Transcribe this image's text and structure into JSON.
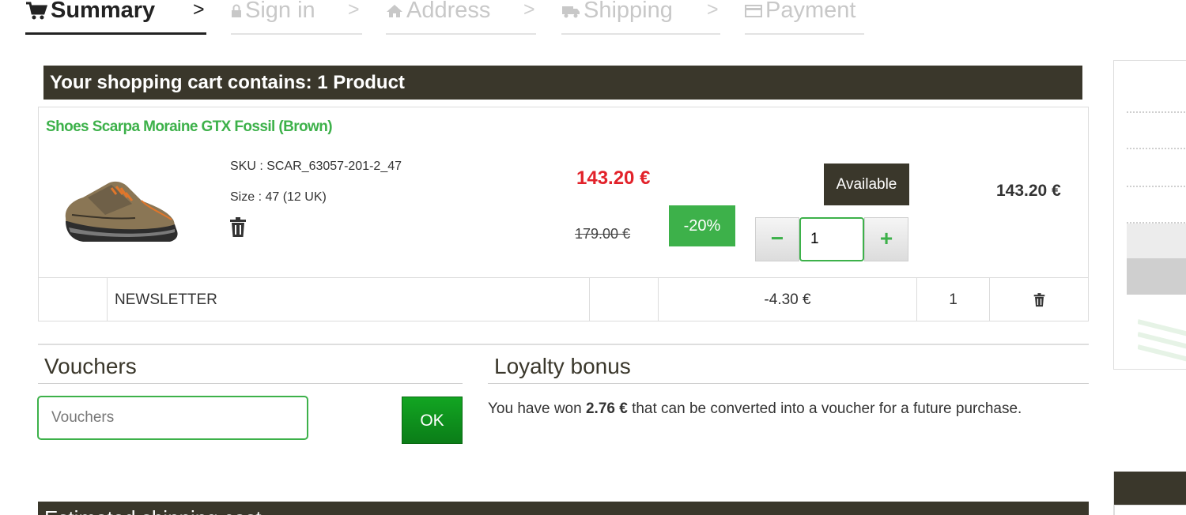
{
  "steps": [
    {
      "label": "Summary",
      "icon": "cart-icon",
      "active": true
    },
    {
      "label": "Sign in",
      "icon": "lock-icon",
      "active": false
    },
    {
      "label": "Address",
      "icon": "home-icon",
      "active": false
    },
    {
      "label": "Shipping",
      "icon": "truck-icon",
      "active": false
    },
    {
      "label": "Payment",
      "icon": "credit-card-icon",
      "active": false
    }
  ],
  "step_separator": ">",
  "cart": {
    "header": "Your shopping cart contains: 1 Product",
    "product": {
      "name": "Shoes Scarpa Moraine GTX Fossil (Brown)",
      "sku": "SKU :  SCAR_63057-201-2_47",
      "size": "Size : 47 (12 UK)",
      "price_now": "143.20 €",
      "price_old": "179.00 €",
      "discount": "-20%",
      "availability": "Available",
      "quantity": "1",
      "qty_minus": "−",
      "qty_plus": "+",
      "line_total": "143.20 €"
    },
    "newsletter": {
      "label": "NEWSLETTER",
      "amount": "-4.30 €",
      "qty": "1"
    }
  },
  "vouchers": {
    "title": "Vouchers",
    "placeholder": "Vouchers",
    "ok_label": "OK"
  },
  "loyalty": {
    "title": "Loyalty bonus",
    "text_before": "You have won ",
    "amount": "2.76 €",
    "text_after": " that can be converted into a voucher for a future purchase."
  },
  "shipping": {
    "header": "Estimated shipping cost"
  },
  "colors": {
    "dark": "#3a372b",
    "green": "#3db14a",
    "red": "#e2222a"
  }
}
